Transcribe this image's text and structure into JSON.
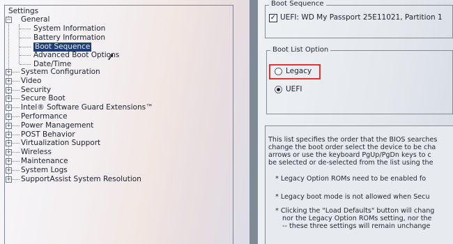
{
  "tree": {
    "root_label": "Settings",
    "general_label": "General",
    "general_children": [
      "System Information",
      "Battery Information",
      "Boot Sequence",
      "Advanced Boot Options",
      "Date/Time"
    ],
    "selected_child": "Boot Sequence",
    "top_level": [
      "System Configuration",
      "Video",
      "Security",
      "Secure Boot",
      "Intel® Software Guard Extensions™",
      "Performance",
      "Power Management",
      "POST Behavior",
      "Virtualization Support",
      "Wireless",
      "Maintenance",
      "System Logs",
      "SupportAssist System Resolution"
    ]
  },
  "boot_sequence": {
    "group_title": "Boot Sequence",
    "entries": [
      {
        "label": "UEFI: WD My Passport 25E11021, Partition 1",
        "checked": true
      }
    ]
  },
  "boot_list_option": {
    "group_title": "Boot List Option",
    "options": [
      {
        "label": "Legacy",
        "selected": false,
        "highlighted": true
      },
      {
        "label": "UEFI",
        "selected": true,
        "highlighted": false
      }
    ]
  },
  "description": {
    "lines": [
      "This list specifies the order that the BIOS searches",
      "change the boot order select the device to be cha",
      "arrows or use the keyboard PgUp/PgDn keys to c",
      "be selected or de-selected from the list using the",
      "* Legacy Option ROMs need to be enabled fo",
      "* Legacy boot mode is not allowed when Secu",
      "* Clicking the \"Load Defaults\" button will chang",
      "nor the Legacy Option ROMs setting, nor the",
      "-- these three settings will remain unchange"
    ]
  },
  "colors": {
    "selection_bg": "#1f3f7a",
    "highlight_border": "#e23333"
  }
}
